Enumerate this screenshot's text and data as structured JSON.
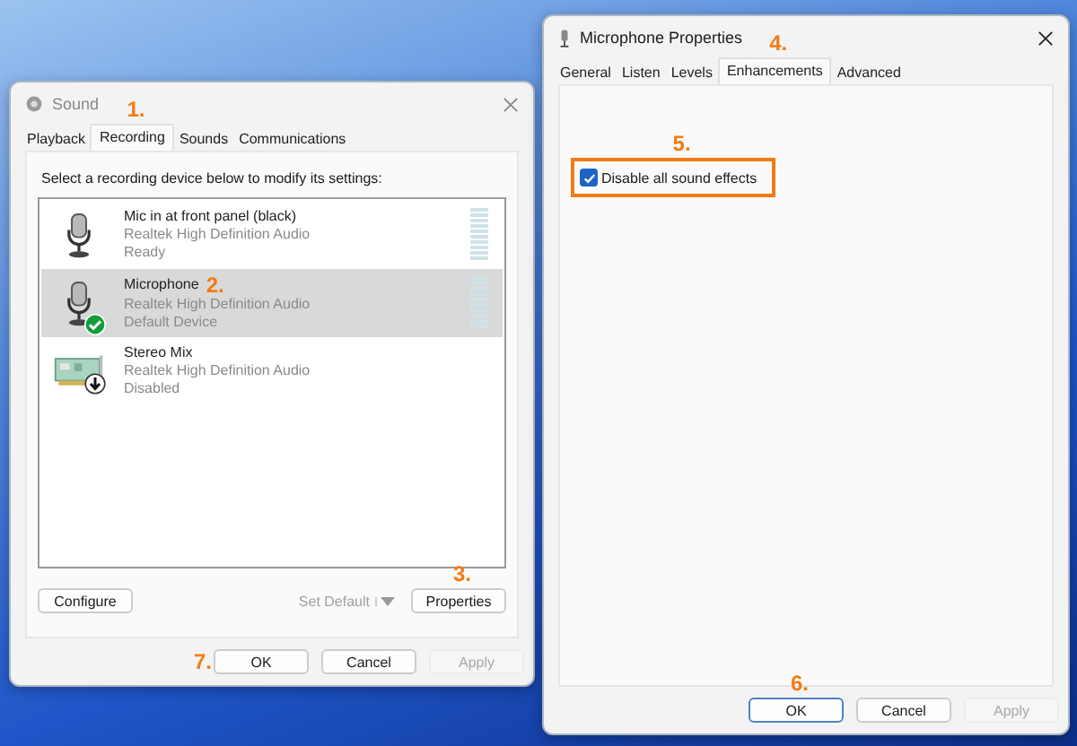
{
  "sound_dialog": {
    "title": "Sound",
    "tabs": [
      {
        "label": "Playback",
        "selected": false
      },
      {
        "label": "Recording",
        "selected": true,
        "step": "1."
      },
      {
        "label": "Sounds",
        "selected": false
      },
      {
        "label": "Communications",
        "selected": false
      }
    ],
    "instruction": "Select a recording device below to modify its settings:",
    "devices": [
      {
        "name": "Mic in at front panel (black)",
        "driver": "Realtek High Definition Audio",
        "status": "Ready",
        "kind": "microphone",
        "default": false,
        "disabled": false,
        "meter": true,
        "selected": false
      },
      {
        "name": "Microphone",
        "driver": "Realtek High Definition Audio",
        "status": "Default Device",
        "kind": "microphone",
        "default": true,
        "disabled": false,
        "meter": true,
        "selected": true,
        "step": "2."
      },
      {
        "name": "Stereo Mix",
        "driver": "Realtek High Definition Audio",
        "status": "Disabled",
        "kind": "board",
        "default": false,
        "disabled": true,
        "meter": false,
        "selected": false
      }
    ],
    "configure": {
      "label": "Configure"
    },
    "set_default": {
      "label": "Set Default",
      "disabled": true
    },
    "properties": {
      "label": "Properties",
      "step": "3."
    },
    "footer_buttons": [
      {
        "label": "OK",
        "disabled": false,
        "step": "7."
      },
      {
        "label": "Cancel",
        "disabled": false
      },
      {
        "label": "Apply",
        "disabled": true
      }
    ]
  },
  "properties_dialog": {
    "title": "Microphone Properties",
    "tabs": [
      {
        "label": "General",
        "selected": false
      },
      {
        "label": "Listen",
        "selected": false
      },
      {
        "label": "Levels",
        "selected": false
      },
      {
        "label": "Enhancements",
        "selected": true,
        "step": "4."
      },
      {
        "label": "Advanced",
        "selected": false
      }
    ],
    "checkbox": {
      "label": "Disable all sound effects",
      "checked": true,
      "step": "5."
    },
    "footer_buttons": [
      {
        "label": "OK",
        "disabled": false,
        "step": "6."
      },
      {
        "label": "Cancel",
        "disabled": false
      },
      {
        "label": "Apply",
        "disabled": true
      }
    ]
  }
}
